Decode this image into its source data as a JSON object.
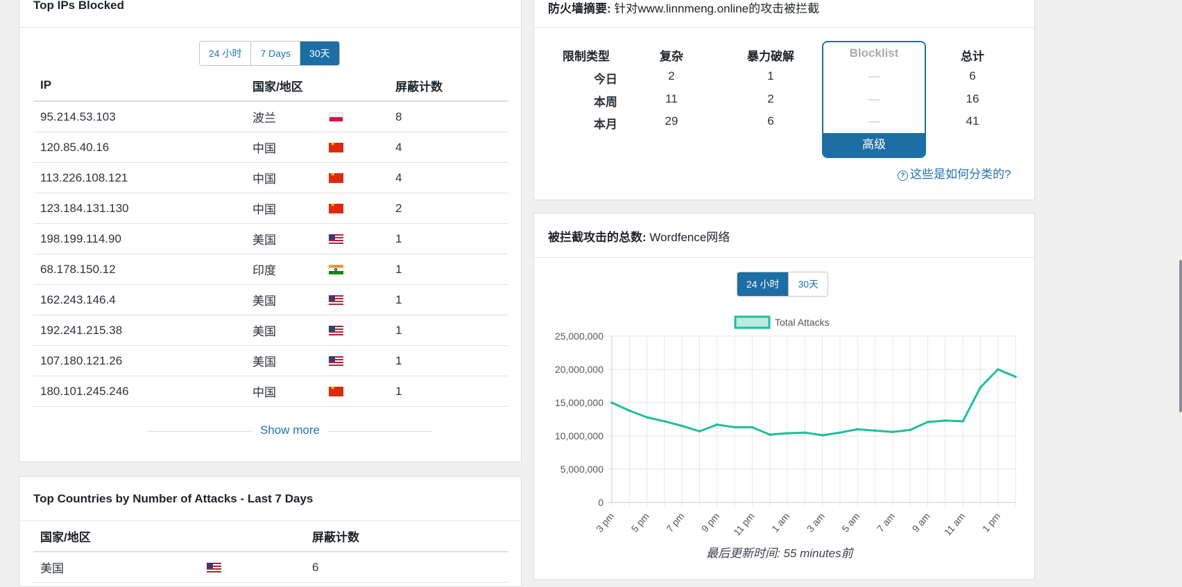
{
  "top_ips": {
    "title": "Top IPs Blocked",
    "ranges": [
      "24 小时",
      "7 Days",
      "30天"
    ],
    "active_range": 2,
    "columns": [
      "IP",
      "国家/地区",
      "屏蔽计数"
    ],
    "rows": [
      {
        "ip": "95.214.53.103",
        "country": "波兰",
        "flag": "pl",
        "count": "8"
      },
      {
        "ip": "120.85.40.16",
        "country": "中国",
        "flag": "cn",
        "count": "4"
      },
      {
        "ip": "113.226.108.121",
        "country": "中国",
        "flag": "cn",
        "count": "4"
      },
      {
        "ip": "123.184.131.130",
        "country": "中国",
        "flag": "cn",
        "count": "2"
      },
      {
        "ip": "198.199.114.90",
        "country": "美国",
        "flag": "us",
        "count": "1"
      },
      {
        "ip": "68.178.150.12",
        "country": "印度",
        "flag": "in",
        "count": "1"
      },
      {
        "ip": "162.243.146.4",
        "country": "美国",
        "flag": "us",
        "count": "1"
      },
      {
        "ip": "192.241.215.38",
        "country": "美国",
        "flag": "us",
        "count": "1"
      },
      {
        "ip": "107.180.121.26",
        "country": "美国",
        "flag": "us",
        "count": "1"
      },
      {
        "ip": "180.101.245.246",
        "country": "中国",
        "flag": "cn",
        "count": "1"
      }
    ],
    "show_more": "Show more"
  },
  "top_countries": {
    "title": "Top Countries by Number of Attacks - Last 7 Days",
    "columns": [
      "国家/地区",
      "屏蔽计数"
    ],
    "rows": [
      {
        "country": "美国",
        "flag": "us",
        "count": "6"
      }
    ]
  },
  "firewall_summary": {
    "title_bold": "防火墙摘要:",
    "title_rest": "针对www.linnmeng.online的攻击被拦截",
    "headers": [
      "限制类型",
      "复杂",
      "暴力破解",
      "Blocklist",
      "总计"
    ],
    "rows": [
      {
        "label": "今日",
        "complex": "2",
        "brute": "1",
        "blocklist": "—",
        "total": "6"
      },
      {
        "label": "本周",
        "complex": "11",
        "brute": "2",
        "blocklist": "—",
        "total": "16"
      },
      {
        "label": "本月",
        "complex": "29",
        "brute": "6",
        "blocklist": "—",
        "total": "41"
      }
    ],
    "premium_label": "高级",
    "help_link": "这些是如何分类的?"
  },
  "total_attacks": {
    "title_bold": "被拦截攻击的总数:",
    "title_rest": "Wordfence网络",
    "ranges": [
      "24 小时",
      "30天"
    ],
    "active_range": 0,
    "updated": "最后更新时间: 55 minutes前"
  },
  "chart_data": {
    "type": "line",
    "title": "",
    "legend": [
      "Total Attacks"
    ],
    "legend_position": "top",
    "grid": true,
    "series_color": "#1fbf9a",
    "x_tick_labels": [
      "3 pm",
      "5 pm",
      "7 pm",
      "9 pm",
      "11 pm",
      "1 am",
      "3 am",
      "5 am",
      "7 am",
      "9 am",
      "11 am",
      "1 pm"
    ],
    "y_tick_labels": [
      "0",
      "5,000,000",
      "10,000,000",
      "15,000,000",
      "20,000,000",
      "25,000,000"
    ],
    "ylim": [
      0,
      25000000
    ],
    "x": [
      "3 pm",
      "4 pm",
      "5 pm",
      "6 pm",
      "7 pm",
      "8 pm",
      "9 pm",
      "10 pm",
      "11 pm",
      "12 am",
      "1 am",
      "2 am",
      "3 am",
      "4 am",
      "5 am",
      "6 am",
      "7 am",
      "8 am",
      "9 am",
      "10 am",
      "11 am",
      "12 pm",
      "1 pm",
      "2 pm"
    ],
    "series": [
      {
        "name": "Total Attacks",
        "values": [
          15000000,
          13800000,
          12800000,
          12200000,
          11500000,
          10700000,
          11700000,
          11300000,
          11300000,
          10200000,
          10400000,
          10500000,
          10100000,
          10500000,
          11000000,
          10800000,
          10600000,
          10900000,
          12100000,
          12300000,
          12200000,
          17300000,
          20000000,
          18900000
        ]
      }
    ]
  }
}
